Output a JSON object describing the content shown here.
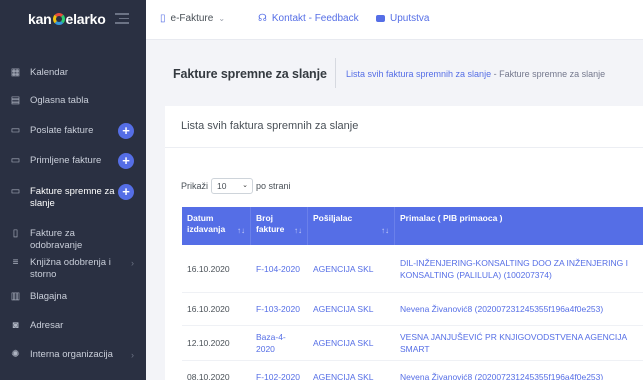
{
  "sidebar": {
    "logo": {
      "left": "kan",
      "right": "elarko"
    },
    "items": [
      {
        "label": "Kalendar",
        "icon": "calendar-icon",
        "glyph": "▦",
        "plus": false,
        "chevron": false
      },
      {
        "label": "Oglasna tabla",
        "icon": "board-icon",
        "glyph": "▤",
        "plus": false,
        "chevron": false
      },
      {
        "label": "Poslate fakture",
        "icon": "folder-out-icon",
        "glyph": "▭",
        "plus": true,
        "chevron": false
      },
      {
        "label": "Primljene fakture",
        "icon": "folder-in-icon",
        "glyph": "▭",
        "plus": true,
        "chevron": false
      },
      {
        "label": "Fakture spremne za slanje",
        "icon": "folder-check-icon",
        "glyph": "▭",
        "plus": true,
        "chevron": false,
        "active": true
      },
      {
        "label": "Fakture za odobravanje",
        "icon": "clipboard-icon",
        "glyph": "▯",
        "plus": false,
        "chevron": false
      },
      {
        "label": "Knjižna odobrenja i storno",
        "icon": "list-icon",
        "glyph": "≡",
        "plus": false,
        "chevron": true
      },
      {
        "label": "Blagajna",
        "icon": "cash-icon",
        "glyph": "▥",
        "plus": false,
        "chevron": false
      },
      {
        "label": "Adresar",
        "icon": "contact-icon",
        "glyph": "◙",
        "plus": false,
        "chevron": false
      },
      {
        "label": "Interna organizacija",
        "icon": "gear-icon",
        "glyph": "✺",
        "plus": false,
        "chevron": true
      }
    ]
  },
  "topbar": {
    "efakture": "e-Fakture",
    "kontakt": "Kontakt - Feedback",
    "uputstva": "Uputstva"
  },
  "page": {
    "title": "Fakture spremne za slanje",
    "breadcrumb_link": "Lista svih faktura spremnih za slanje",
    "breadcrumb_sep": " - ",
    "breadcrumb_current": "Fakture spremne za slanje"
  },
  "card": {
    "title": "Lista svih faktura spremnih za slanje",
    "show_prefix": "Prikaži",
    "show_value": "10",
    "show_suffix": "po strani"
  },
  "table": {
    "headers": [
      {
        "label": "Datum izdavanja"
      },
      {
        "label": "Broj fakture"
      },
      {
        "label": "Pošiljalac"
      },
      {
        "label": "Primalac ( PIB primaoca )"
      }
    ],
    "rows": [
      {
        "datum": "16.10.2020",
        "broj": "F-104-2020",
        "posiljalac": "AGENCIJA SKL",
        "primalac": "DIL-INŽENJERING-KONSALTING DOO ZA INŽENJERING I KONSALTING (PALILULA) (100207374)"
      },
      {
        "datum": "16.10.2020",
        "broj": "F-103-2020",
        "posiljalac": "AGENCIJA SKL",
        "primalac": "Nevena Živanović8 (20200723124535​5f196a4f0e253)"
      },
      {
        "datum": "12.10.2020",
        "broj": "Baza-4-2020",
        "posiljalac": "AGENCIJA SKL",
        "primalac": "VESNA JANJUŠEVIĆ PR KNJIGOVODSTVENA AGENCIJA SMART"
      },
      {
        "datum": "08.10.2020",
        "broj": "F-102-2020",
        "posiljalac": "AGENCIJA SKL",
        "primalac": "Nevena Živanović8 (202007231245355f196a4f0e253)"
      }
    ]
  }
}
